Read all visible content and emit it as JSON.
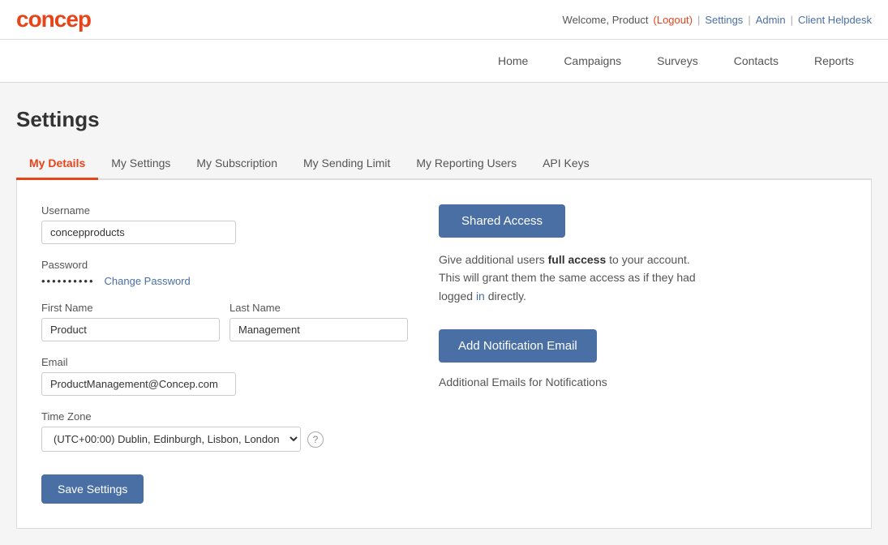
{
  "logo": {
    "text": "concep"
  },
  "topbar": {
    "welcome": "Welcome, Product",
    "logout": "(Logout)",
    "settings": "Settings",
    "separator1": "|",
    "admin": "Admin",
    "separator2": "|",
    "helpdesk": "Client Helpdesk"
  },
  "nav": {
    "items": [
      {
        "label": "Home"
      },
      {
        "label": "Campaigns"
      },
      {
        "label": "Surveys"
      },
      {
        "label": "Contacts"
      },
      {
        "label": "Reports"
      }
    ]
  },
  "page": {
    "title": "Settings"
  },
  "tabs": [
    {
      "label": "My Details",
      "active": true
    },
    {
      "label": "My Settings",
      "active": false
    },
    {
      "label": "My Subscription",
      "active": false
    },
    {
      "label": "My Sending Limit",
      "active": false
    },
    {
      "label": "My Reporting Users",
      "active": false
    },
    {
      "label": "API Keys",
      "active": false
    }
  ],
  "form": {
    "username_label": "Username",
    "username_value": "concepproducts",
    "password_label": "Password",
    "password_dots": "••••••••••",
    "change_password": "Change Password",
    "firstname_label": "First Name",
    "firstname_value": "Product",
    "lastname_label": "Last Name",
    "lastname_value": "Management",
    "email_label": "Email",
    "email_value": "ProductManagement@Concep.com",
    "timezone_label": "Time Zone",
    "timezone_value": "(UTC+00:00) Dublin, Edinburgh, Lisbon, London",
    "save_button": "Save Settings"
  },
  "right": {
    "shared_access_btn": "Shared Access",
    "shared_access_desc_line1": "Give additional users ",
    "shared_access_bold": "full access",
    "shared_access_desc_line2": " to your account.",
    "shared_access_desc_line3": "This will grant them the same access as if they had logged ",
    "shared_access_blue": "in",
    "shared_access_desc_line4": " directly.",
    "add_notif_btn": "Add Notification Email",
    "add_notif_desc": "Additional Emails for Notifications"
  },
  "help_icon": "?"
}
